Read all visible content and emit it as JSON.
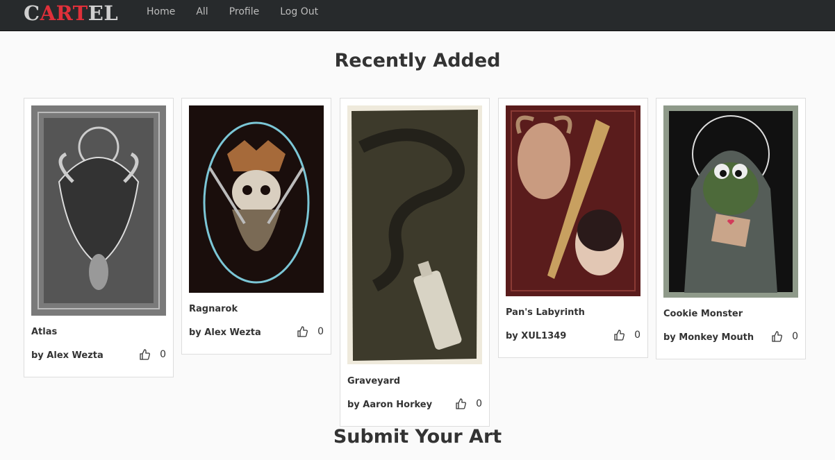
{
  "brand": {
    "part1": "C",
    "part2": "ART",
    "part3": "EL"
  },
  "nav": {
    "home": "Home",
    "all": "All",
    "profile": "Profile",
    "logout": "Log Out"
  },
  "recent_title": "Recently Added",
  "submit_title": "Submit Your Art",
  "cards": [
    {
      "title": "Atlas",
      "author": "by Alex Wezta",
      "likes": "0"
    },
    {
      "title": "Ragnarok",
      "author": "by Alex Wezta",
      "likes": "0"
    },
    {
      "title": "Graveyard",
      "author": "by Aaron Horkey",
      "likes": "0"
    },
    {
      "title": "Pan's Labyrinth",
      "author": "by XUL1349",
      "likes": "0"
    },
    {
      "title": "Cookie Monster",
      "author": "by Monkey Mouth",
      "likes": "0"
    }
  ],
  "colors": {
    "navbar": "#272a2c",
    "brand_red": "#e0303a",
    "brand_gray": "#cfcfcf"
  }
}
